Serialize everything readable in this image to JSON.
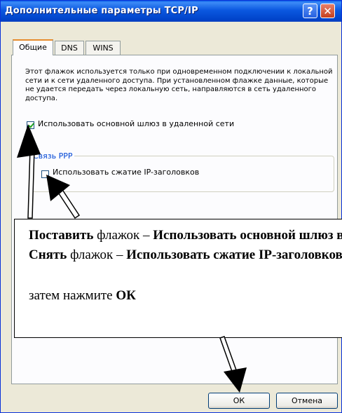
{
  "window": {
    "title": "Дополнительные параметры TCP/IP",
    "help_label": "?",
    "close_label": "✕"
  },
  "tabs": [
    {
      "label": "Общие",
      "active": true
    },
    {
      "label": "DNS",
      "active": false
    },
    {
      "label": "WINS",
      "active": false
    }
  ],
  "general": {
    "description": "Этот флажок используется только при одновременном подключении к локальной сети и к сети удаленного доступа. При установленном флажке данные, которые не удается передать через локальную сеть, направляются в сеть удаленного доступа.",
    "gateway_checkbox_label": "Использовать основной шлюз в удаленной сети",
    "gateway_checked": true,
    "ppp_group_label": "Связь PPP",
    "compression_checkbox_label": "Использовать сжатие IP-заголовков",
    "compression_checked": false
  },
  "instruction": {
    "line1_bold": "Поставить",
    "line1_mid": " флажок – ",
    "line1_bold2": "Использовать основной шлюз в удаленной сети",
    "line2_bold": "Снять",
    "line2_mid": " флажок – ",
    "line2_bold2": "Использовать сжатие IP-заголовков",
    "line3_text": "затем нажмите ",
    "line3_bold": "ОК"
  },
  "buttons": {
    "ok_label": "ОК",
    "cancel_label": "Отмена"
  },
  "colors": {
    "titlebar": "#0b58e0",
    "group_label": "#0046d5",
    "tab_highlight": "#e68b2c"
  }
}
